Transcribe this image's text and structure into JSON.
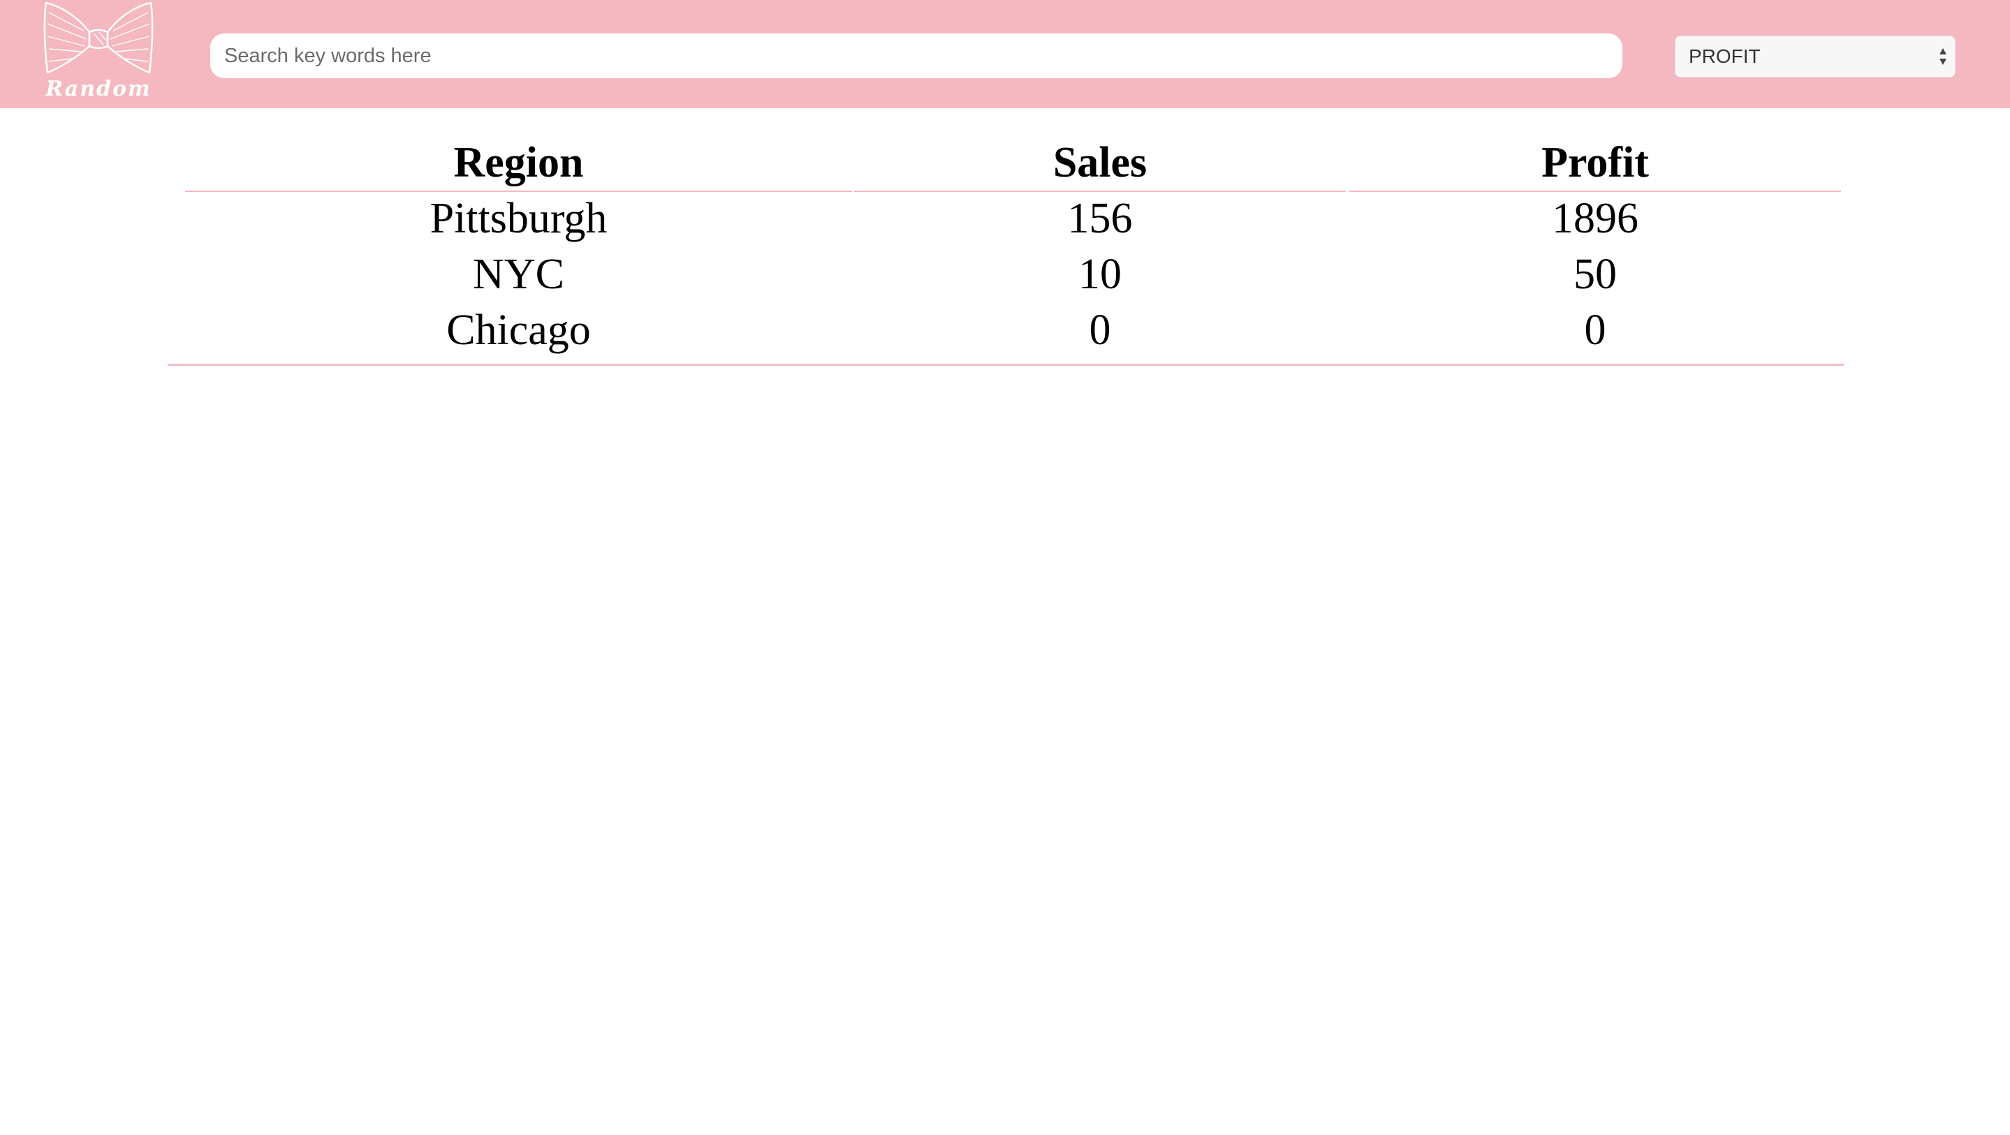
{
  "brand": {
    "logo_text": "Random",
    "logo_icon": "bow-tie-icon"
  },
  "search": {
    "placeholder": "Search key words here",
    "value": ""
  },
  "sort_select": {
    "selected": "PROFIT"
  },
  "table": {
    "headers": [
      "Region",
      "Sales",
      "Profit"
    ],
    "rows": [
      [
        "Pittsburgh",
        "156",
        "1896"
      ],
      [
        "NYC",
        "10",
        "50"
      ],
      [
        "Chicago",
        "0",
        "0"
      ]
    ]
  },
  "colors": {
    "accent": "#f5b8c0",
    "background": "#ffffff"
  }
}
